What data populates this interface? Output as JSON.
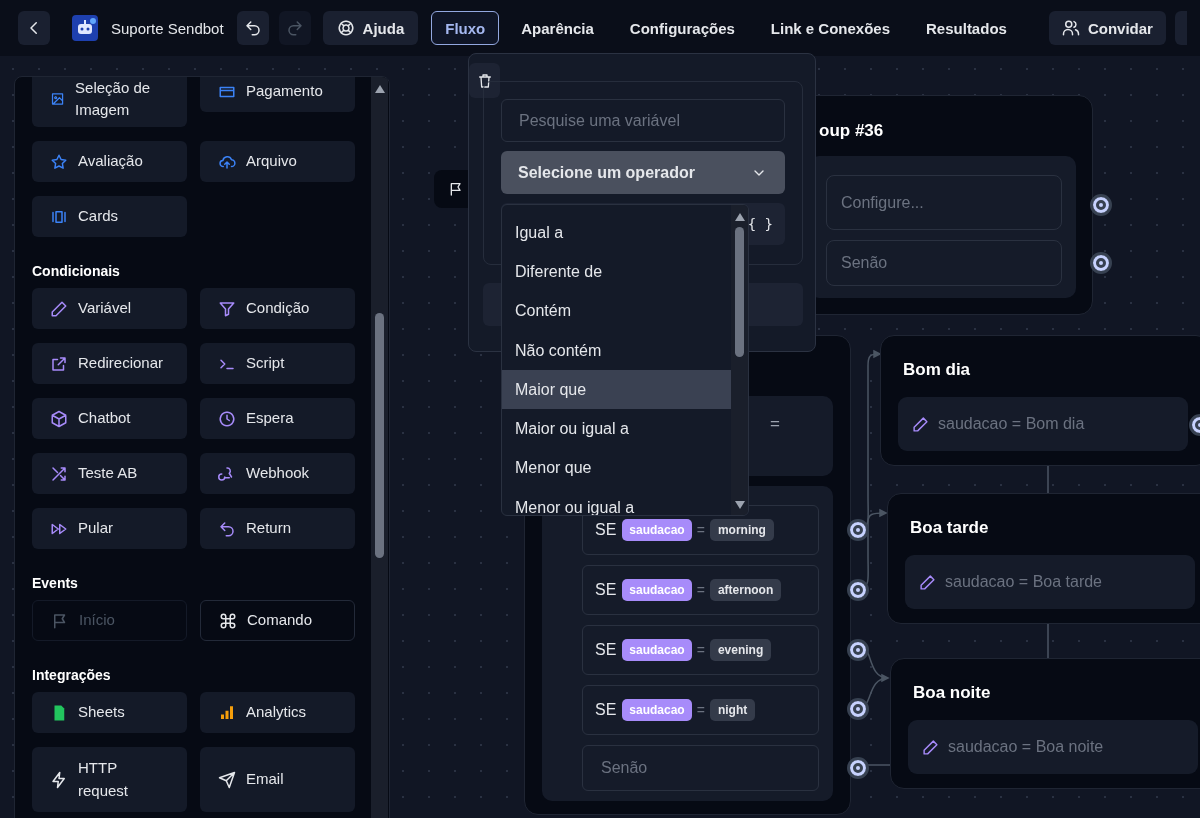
{
  "topbar": {
    "bot_name": "Suporte Sendbot",
    "help": "Ajuda",
    "invite": "Convidar",
    "tabs": [
      {
        "label": "Fluxo",
        "selected": true
      },
      {
        "label": "Aparência",
        "selected": false
      },
      {
        "label": "Configurações",
        "selected": false
      },
      {
        "label": "Link e Conexões",
        "selected": false
      },
      {
        "label": "Resultados",
        "selected": false
      }
    ]
  },
  "sidebar": {
    "sections": [
      {
        "items": [
          {
            "label": "Seleção de Imagem",
            "disabled": false
          },
          {
            "label": "Pagamento",
            "disabled": false
          },
          {
            "label": "Avaliação",
            "disabled": false
          },
          {
            "label": "Arquivo",
            "disabled": false
          },
          {
            "label": "Cards",
            "disabled": false
          }
        ]
      },
      {
        "title": "Condicionais",
        "items": [
          {
            "label": "Variável",
            "disabled": false
          },
          {
            "label": "Condição",
            "disabled": false
          },
          {
            "label": "Redirecionar",
            "disabled": false
          },
          {
            "label": "Script",
            "disabled": false
          },
          {
            "label": "Chatbot",
            "disabled": false
          },
          {
            "label": "Espera",
            "disabled": false
          },
          {
            "label": "Teste AB",
            "disabled": false
          },
          {
            "label": "Webhook",
            "disabled": false
          },
          {
            "label": "Pular",
            "disabled": false
          },
          {
            "label": "Return",
            "disabled": false
          }
        ]
      },
      {
        "title": "Events",
        "items": [
          {
            "label": "Início",
            "disabled": true
          },
          {
            "label": "Comando",
            "disabled": false
          }
        ]
      },
      {
        "title": "Integrações",
        "items": [
          {
            "label": "Sheets",
            "disabled": false
          },
          {
            "label": "Analytics",
            "disabled": false
          },
          {
            "label": "HTTP request",
            "disabled": false
          },
          {
            "label": "Email",
            "disabled": false
          }
        ]
      }
    ]
  },
  "popup": {
    "search_placeholder": "Pesquise uma variável",
    "operator_select": "Selecione um operador",
    "value_suffix": "{ }",
    "options": [
      {
        "label": "Igual a",
        "highlighted": false
      },
      {
        "label": "Diferente de",
        "highlighted": false
      },
      {
        "label": "Contém",
        "highlighted": false
      },
      {
        "label": "Não contém",
        "highlighted": false
      },
      {
        "label": "Maior que",
        "highlighted": true
      },
      {
        "label": "Maior ou igual a",
        "highlighted": false
      },
      {
        "label": "Menor que",
        "highlighted": false
      },
      {
        "label": "Menor ou igual a",
        "highlighted": false
      }
    ]
  },
  "canvas": {
    "group_node": {
      "title": "oup #36",
      "condition_placeholder": "Configure...",
      "else_label": "Senão"
    },
    "condition_node": {
      "hidden_operator": "=",
      "else_label": "Senão",
      "conditions": [
        {
          "keyword": "SE",
          "variable": "saudacao",
          "operator": "=",
          "value": "morning"
        },
        {
          "keyword": "SE",
          "variable": "saudacao",
          "operator": "=",
          "value": "afternoon"
        },
        {
          "keyword": "SE",
          "variable": "saudacao",
          "operator": "=",
          "value": "evening"
        },
        {
          "keyword": "SE",
          "variable": "saudacao",
          "operator": "=",
          "value": "night"
        }
      ]
    },
    "set_nodes": [
      {
        "title": "Bom dia",
        "text": "saudacao = Bom dia"
      },
      {
        "title": "Boa tarde",
        "text": "saudacao = Boa tarde"
      },
      {
        "title": "Boa noite",
        "text": "saudacao = Boa noite"
      }
    ]
  }
}
